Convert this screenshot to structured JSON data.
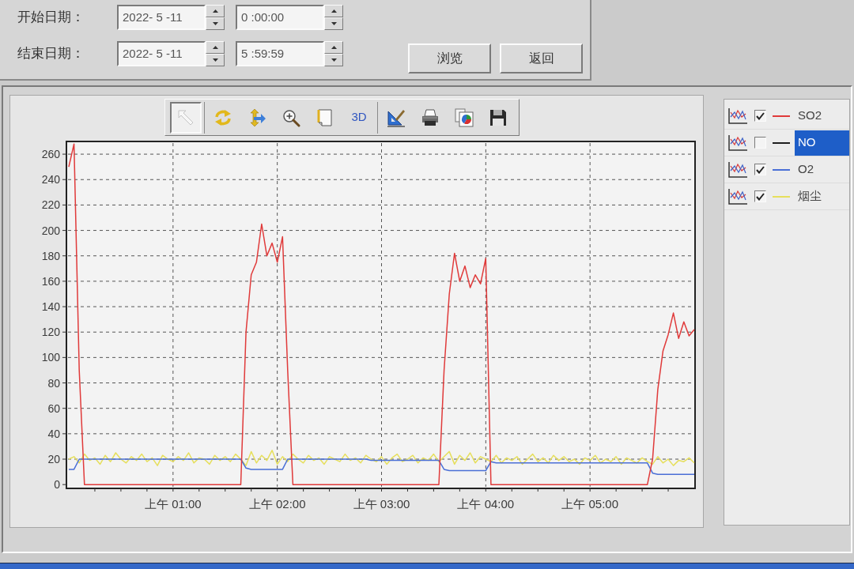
{
  "filter": {
    "rows": [
      {
        "label": "开始日期：",
        "date": "2022- 5 -11",
        "time": "0 :00:00"
      },
      {
        "label": "结束日期：",
        "date": "2022- 5 -11",
        "time": "5 :59:59"
      }
    ],
    "buttons": [
      {
        "label": "浏览"
      },
      {
        "label": "返回"
      }
    ]
  },
  "chart": {
    "toolbar": {
      "groups": [
        {
          "buttons": [
            {
              "selected": true
            }
          ]
        },
        {
          "buttons": [
            {
              "selected": false
            },
            {
              "selected": false
            },
            {
              "selected": false
            },
            {
              "selected": false
            },
            {
              "label": "3D",
              "selected": false
            }
          ]
        },
        {
          "buttons": [
            {
              "selected": false
            },
            {
              "selected": false
            },
            {
              "selected": false
            },
            {
              "selected": false
            }
          ]
        }
      ]
    },
    "chart_data": {
      "type": "line",
      "ylim": [
        -3,
        270
      ],
      "grid": true,
      "yticks": [
        0,
        20,
        40,
        60,
        80,
        100,
        120,
        140,
        160,
        180,
        200,
        220,
        240,
        260
      ],
      "categories": [
        null,
        null,
        null,
        null,
        null,
        null,
        null,
        null,
        null,
        null,
        null,
        null,
        null,
        null,
        null,
        null,
        null,
        null,
        null,
        null,
        "上午 01:00",
        null,
        null,
        null,
        null,
        null,
        null,
        null,
        null,
        null,
        null,
        null,
        null,
        null,
        null,
        null,
        null,
        null,
        null,
        null,
        "上午 02:00",
        null,
        null,
        null,
        null,
        null,
        null,
        null,
        null,
        null,
        null,
        null,
        null,
        null,
        null,
        null,
        null,
        null,
        null,
        null,
        "上午 03:00",
        null,
        null,
        null,
        null,
        null,
        null,
        null,
        null,
        null,
        null,
        null,
        null,
        null,
        null,
        null,
        null,
        null,
        null,
        null,
        "上午 04:00",
        null,
        null,
        null,
        null,
        null,
        null,
        null,
        null,
        null,
        null,
        null,
        null,
        null,
        null,
        null,
        null,
        null,
        null,
        null,
        "上午 05:00",
        null,
        null,
        null,
        null,
        null,
        null,
        null,
        null,
        null,
        null,
        null,
        null,
        null,
        null,
        null,
        null,
        null,
        null,
        null,
        null
      ],
      "series": [
        {
          "color": "#e03a3a",
          "values": [
            250,
            268,
            90,
            0,
            0,
            0,
            0,
            0,
            0,
            0,
            0,
            0,
            0,
            0,
            0,
            0,
            0,
            0,
            0,
            0,
            0,
            0,
            0,
            0,
            0,
            0,
            0,
            0,
            0,
            0,
            0,
            0,
            0,
            0,
            120,
            165,
            175,
            205,
            180,
            190,
            175,
            195,
            90,
            0,
            0,
            0,
            0,
            0,
            0,
            0,
            0,
            0,
            0,
            0,
            0,
            0,
            0,
            0,
            0,
            0,
            0,
            0,
            0,
            0,
            0,
            0,
            0,
            0,
            0,
            0,
            0,
            0,
            90,
            150,
            182,
            160,
            172,
            155,
            165,
            158,
            178,
            0,
            0,
            0,
            0,
            0,
            0,
            0,
            0,
            0,
            0,
            0,
            0,
            0,
            0,
            0,
            0,
            0,
            0,
            0,
            0,
            0,
            0,
            0,
            0,
            0,
            0,
            0,
            0,
            0,
            0,
            0,
            20,
            75,
            105,
            118,
            135,
            115,
            128,
            117,
            122
          ]
        },
        {
          "color": "#4a6fd6",
          "values": [
            12,
            12,
            20,
            20,
            20,
            20,
            20,
            20,
            20,
            20,
            20,
            20,
            20,
            20,
            20,
            20,
            20,
            20,
            20,
            20,
            20,
            20,
            20,
            20,
            20,
            20,
            20,
            20,
            20,
            20,
            20,
            20,
            20,
            20,
            13,
            12,
            12,
            12,
            12,
            12,
            12,
            12,
            20,
            20,
            20,
            20,
            20,
            20,
            20,
            20,
            20,
            20,
            20,
            20,
            20,
            20,
            20,
            20,
            19,
            19,
            19,
            19,
            19,
            19,
            19,
            19,
            19,
            19,
            19,
            19,
            19,
            19,
            12,
            11,
            11,
            11,
            11,
            11,
            11,
            11,
            11,
            18,
            17,
            17,
            17,
            17,
            17,
            17,
            17,
            17,
            17,
            17,
            17,
            17,
            17,
            17,
            17,
            17,
            17,
            17,
            17,
            17,
            17,
            17,
            17,
            17,
            17,
            17,
            17,
            17,
            17,
            17,
            9,
            8,
            8,
            8,
            8,
            8,
            8,
            8,
            8
          ]
        },
        {
          "color": "#e6df5c",
          "values": [
            20,
            22,
            17,
            24,
            19,
            21,
            16,
            23,
            18,
            25,
            20,
            17,
            22,
            19,
            24,
            18,
            21,
            15,
            23,
            20,
            18,
            22,
            19,
            25,
            17,
            21,
            20,
            16,
            23,
            19,
            22,
            18,
            24,
            20,
            15,
            26,
            17,
            23,
            19,
            27,
            16,
            22,
            18,
            24,
            20,
            17,
            23,
            19,
            21,
            16,
            22,
            20,
            18,
            24,
            19,
            21,
            17,
            23,
            20,
            18,
            22,
            16,
            21,
            24,
            18,
            20,
            23,
            17,
            21,
            19,
            24,
            18,
            22,
            26,
            16,
            23,
            19,
            25,
            17,
            22,
            20,
            18,
            23,
            17,
            21,
            19,
            22,
            16,
            20,
            24,
            18,
            21,
            17,
            23,
            19,
            22,
            18,
            20,
            16,
            21,
            19,
            23,
            17,
            20,
            18,
            22,
            16,
            21,
            19,
            17,
            21,
            18,
            16,
            22,
            17,
            20,
            15,
            19,
            18,
            21,
            17
          ]
        }
      ]
    },
    "legend": {
      "items": [
        {
          "label": "SO2",
          "color": "#e03a3a",
          "checked": true,
          "selected": false
        },
        {
          "label": "NO",
          "color": "#1e1e1e",
          "checked": false,
          "selected": true
        },
        {
          "label": "O2",
          "color": "#4a6fd6",
          "checked": true,
          "selected": false
        },
        {
          "label": "烟尘",
          "color": "#e6df5c",
          "checked": true,
          "selected": false
        }
      ]
    }
  }
}
